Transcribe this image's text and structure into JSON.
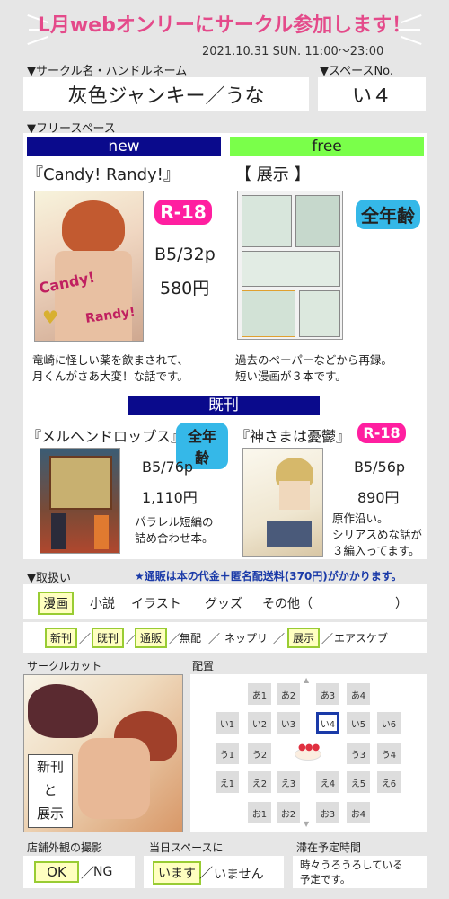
{
  "header": {
    "title_pre": "L月webオンリー",
    "title_post": "にサークル参加します！",
    "date": "2021.10.31 SUN.  11:00～23:00"
  },
  "circle": {
    "name_label": "▼サークル名・ハンドルネーム",
    "name_value": "灰色ジャンキー／うな",
    "space_label": "▼スペースNo.",
    "space_value": "い４"
  },
  "free_space": {
    "label": "▼フリースペース",
    "new": {
      "bar": "new",
      "title": "『Candy! Randy!』",
      "rating": "R-18",
      "size": "B5/32p",
      "price": "580円",
      "desc1": "竜崎に怪しい薬を飲まされて、",
      "desc2": "月くんがさあ大変！な話です。",
      "cover_text1": "Candy!",
      "cover_text2": "Randy!"
    },
    "free": {
      "bar": "free",
      "title": "【 展示 】",
      "rating": "全年齢",
      "desc1": "過去のペーパーなどから再録。",
      "desc2": "短い漫画が３本です。"
    },
    "kikan_bar": "既刊",
    "kikan1": {
      "title": "『メルヘンドロップス』",
      "rating": "全年齢",
      "size": "B5/76p",
      "price": "1,110円",
      "desc1": "パラレル短編の",
      "desc2": "詰め合わせ本。"
    },
    "kikan2": {
      "title": "『神さまは憂鬱』",
      "rating": "R-18",
      "size": "B5/56p",
      "price": "890円",
      "desc1": "原作沿い。",
      "desc2": "シリアスめな話が",
      "desc3": "３編入ってます。"
    }
  },
  "handling": {
    "label": "▼取扱い",
    "notice": "★通販は本の代金＋匿名配送料(370円)がかかります。",
    "types": [
      "漫画",
      "小説",
      "イラスト",
      "グッズ",
      "その他（",
      "）"
    ],
    "tags": [
      "新刊",
      "既刊",
      "通販",
      "無配",
      "ネップリ",
      "展示",
      "エアスケブ"
    ],
    "seps": [
      "／",
      "／",
      "／",
      "／",
      "／",
      "／"
    ]
  },
  "circle_cut": {
    "label": "サークルカット",
    "stamp1": "新刊",
    "stamp2": "と",
    "stamp3": "展示"
  },
  "layout_map": {
    "label": "配置",
    "row1": [
      "あ1",
      "あ2",
      "あ3",
      "あ4"
    ],
    "row2": [
      "い1",
      "い2",
      "い3",
      "い4",
      "い5",
      "い6"
    ],
    "row3": [
      "う1",
      "う2",
      "う3",
      "う4"
    ],
    "row4": [
      "え1",
      "え2",
      "え3",
      "え4",
      "え5",
      "え6"
    ],
    "row5": [
      "お1",
      "お2",
      "お3",
      "お4"
    ]
  },
  "photo": {
    "label": "店舗外観の撮影",
    "ok": "OK",
    "sep": "／",
    "ng": "NG"
  },
  "day_space": {
    "label": "当日スペースに",
    "yes": "います",
    "sep": "／",
    "no": "いません"
  },
  "stay": {
    "label": "滞在予定時間",
    "line1": "時々うろうろしている",
    "line2": "予定です。"
  },
  "colors": {
    "pink": "#e44a8a",
    "navy": "#0a0a8c",
    "green": "#7aff4a",
    "magenta": "#ff1fa0",
    "skyblue": "#35b8e8"
  }
}
